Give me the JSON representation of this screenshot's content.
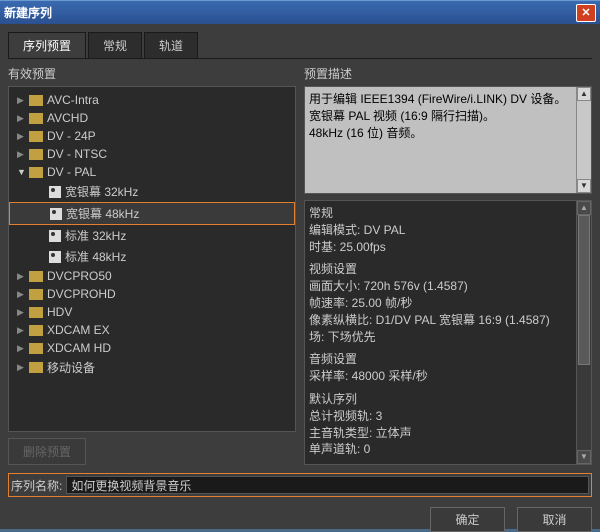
{
  "window": {
    "title": "新建序列"
  },
  "tabs": [
    {
      "label": "序列预置",
      "active": true
    },
    {
      "label": "常规",
      "active": false
    },
    {
      "label": "轨道",
      "active": false
    }
  ],
  "presets": {
    "panel_title": "有效预置",
    "items": [
      {
        "label": "AVC-Intra",
        "type": "folder",
        "level": 1,
        "open": false
      },
      {
        "label": "AVCHD",
        "type": "folder",
        "level": 1,
        "open": false
      },
      {
        "label": "DV - 24P",
        "type": "folder",
        "level": 1,
        "open": false
      },
      {
        "label": "DV - NTSC",
        "type": "folder",
        "level": 1,
        "open": false
      },
      {
        "label": "DV - PAL",
        "type": "folder",
        "level": 1,
        "open": true
      },
      {
        "label": "宽银幕 32kHz",
        "type": "preset",
        "level": 2
      },
      {
        "label": "宽银幕 48kHz",
        "type": "preset",
        "level": 2,
        "selected": true
      },
      {
        "label": "标准 32kHz",
        "type": "preset",
        "level": 2
      },
      {
        "label": "标准 48kHz",
        "type": "preset",
        "level": 2
      },
      {
        "label": "DVCPRO50",
        "type": "folder",
        "level": 1,
        "open": false
      },
      {
        "label": "DVCPROHD",
        "type": "folder",
        "level": 1,
        "open": false
      },
      {
        "label": "HDV",
        "type": "folder",
        "level": 1,
        "open": false
      },
      {
        "label": "XDCAM EX",
        "type": "folder",
        "level": 1,
        "open": false
      },
      {
        "label": "XDCAM HD",
        "type": "folder",
        "level": 1,
        "open": false
      },
      {
        "label": "移动设备",
        "type": "folder",
        "level": 1,
        "open": false
      }
    ],
    "delete_label": "删除预置"
  },
  "description": {
    "panel_title": "预置描述",
    "top": {
      "line1": "用于编辑 IEEE1394 (FireWire/i.LINK) DV 设备。",
      "line2": "宽银幕 PAL 视频 (16:9 隔行扫描)。",
      "line3": "48kHz (16 位) 音频。"
    },
    "bottom": {
      "general_h": "常规",
      "general_l1": "编辑模式: DV PAL",
      "general_l2": "时基: 25.00fps",
      "video_h": "视频设置",
      "video_l1": "画面大小: 720h 576v (1.4587)",
      "video_l2": "帧速率: 25.00 帧/秒",
      "video_l3": "像素纵横比: D1/DV PAL 宽银幕 16:9 (1.4587)",
      "video_l4": "场: 下场优先",
      "audio_h": "音频设置",
      "audio_l1": "采样率: 48000 采样/秒",
      "default_h": "默认序列",
      "default_l1": "总计视频轨: 3",
      "default_l2": "主音轨类型: 立体声",
      "default_l3": "单声道轨: 0"
    }
  },
  "sequence_name": {
    "label": "序列名称:",
    "value": "如何更换视频背景音乐"
  },
  "footer": {
    "ok": "确定",
    "cancel": "取消"
  }
}
